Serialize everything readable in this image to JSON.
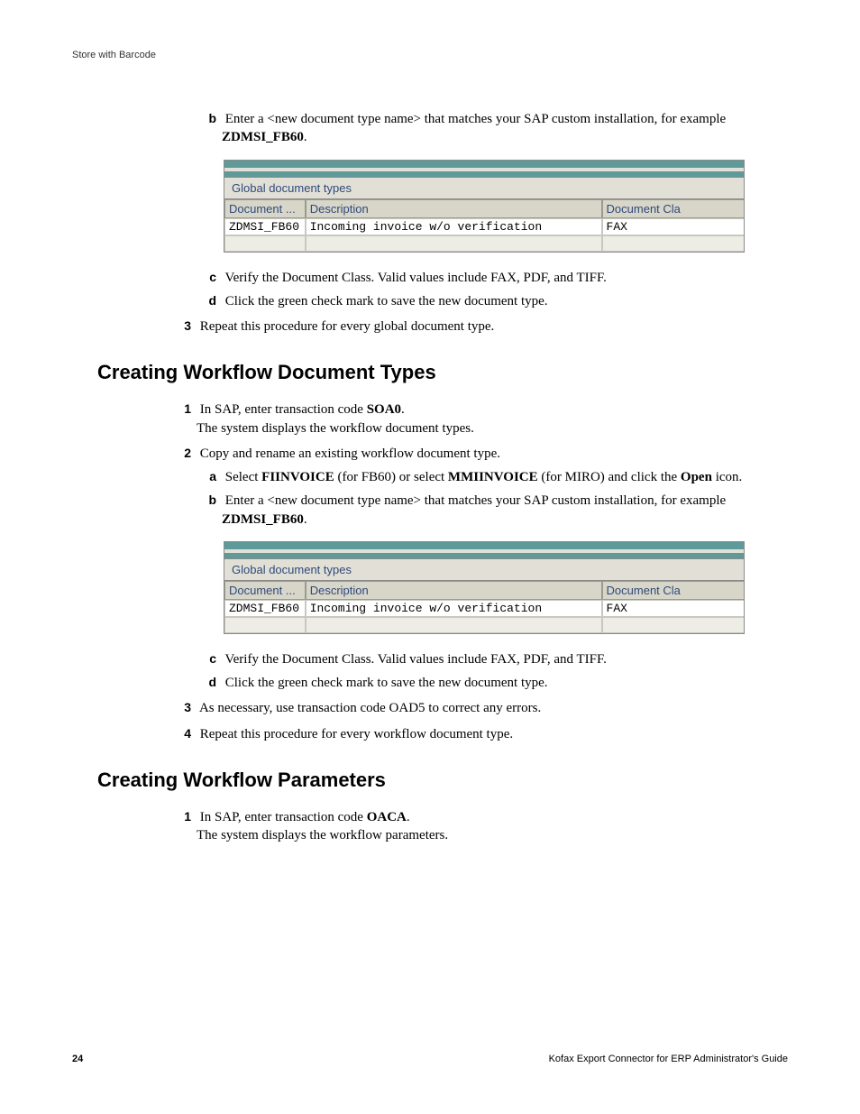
{
  "header": {
    "running": "Store with Barcode"
  },
  "top": {
    "b_pre": "Enter a <new document type name> that matches your SAP custom installation, for example ",
    "b_bold": "ZDMSI_FB60",
    "b_post": ".",
    "c": "Verify the Document Class. Valid values include FAX, PDF, and TIFF.",
    "d": "Click the green check mark to save the new document type.",
    "s3": "Repeat this procedure for every global document type."
  },
  "sap": {
    "title": "Global document types",
    "h_doc": "Document ...",
    "h_desc": "Description",
    "h_cls": "Document Cla",
    "r_doc": "ZDMSI_FB60",
    "r_desc": "Incoming invoice w/o verification",
    "r_cls": "FAX"
  },
  "sec1": {
    "title": "Creating Workflow Document Types",
    "s1a": "In SAP, enter transaction code ",
    "s1b": "SOA0",
    "s1c": ".",
    "s1d": "The system displays the workflow document types.",
    "s2": "Copy and rename an existing workflow document type.",
    "a_pre": "Select ",
    "a_b1": "FIINVOICE",
    "a_mid1": " (for FB60) or select ",
    "a_b2": "MMIINVOICE",
    "a_mid2": " (for MIRO) and click the ",
    "a_b3": "Open",
    "a_post": " icon.",
    "b_pre": "Enter a <new document type name> that matches your SAP custom installation, for example ",
    "b_bold": "ZDMSI_FB60",
    "b_post": ".",
    "c": "Verify the Document Class. Valid values include FAX, PDF, and TIFF.",
    "d": "Click the green check mark to save the new document type.",
    "s3": "As necessary, use transaction code OAD5 to correct any errors.",
    "s4": "Repeat this procedure for every workflow document type."
  },
  "sec2": {
    "title": "Creating Workflow Parameters",
    "s1a": "In SAP, enter transaction code ",
    "s1b": "OACA",
    "s1c": ".",
    "s1d": "The system displays the workflow parameters."
  },
  "labels": {
    "m_b": "b",
    "m_c": "c",
    "m_d": "d",
    "m_a": "a",
    "m_1": "1",
    "m_2": "2",
    "m_3": "3",
    "m_4": "4"
  },
  "footer": {
    "page": "24",
    "right": "Kofax Export Connector for ERP Administrator's Guide"
  }
}
